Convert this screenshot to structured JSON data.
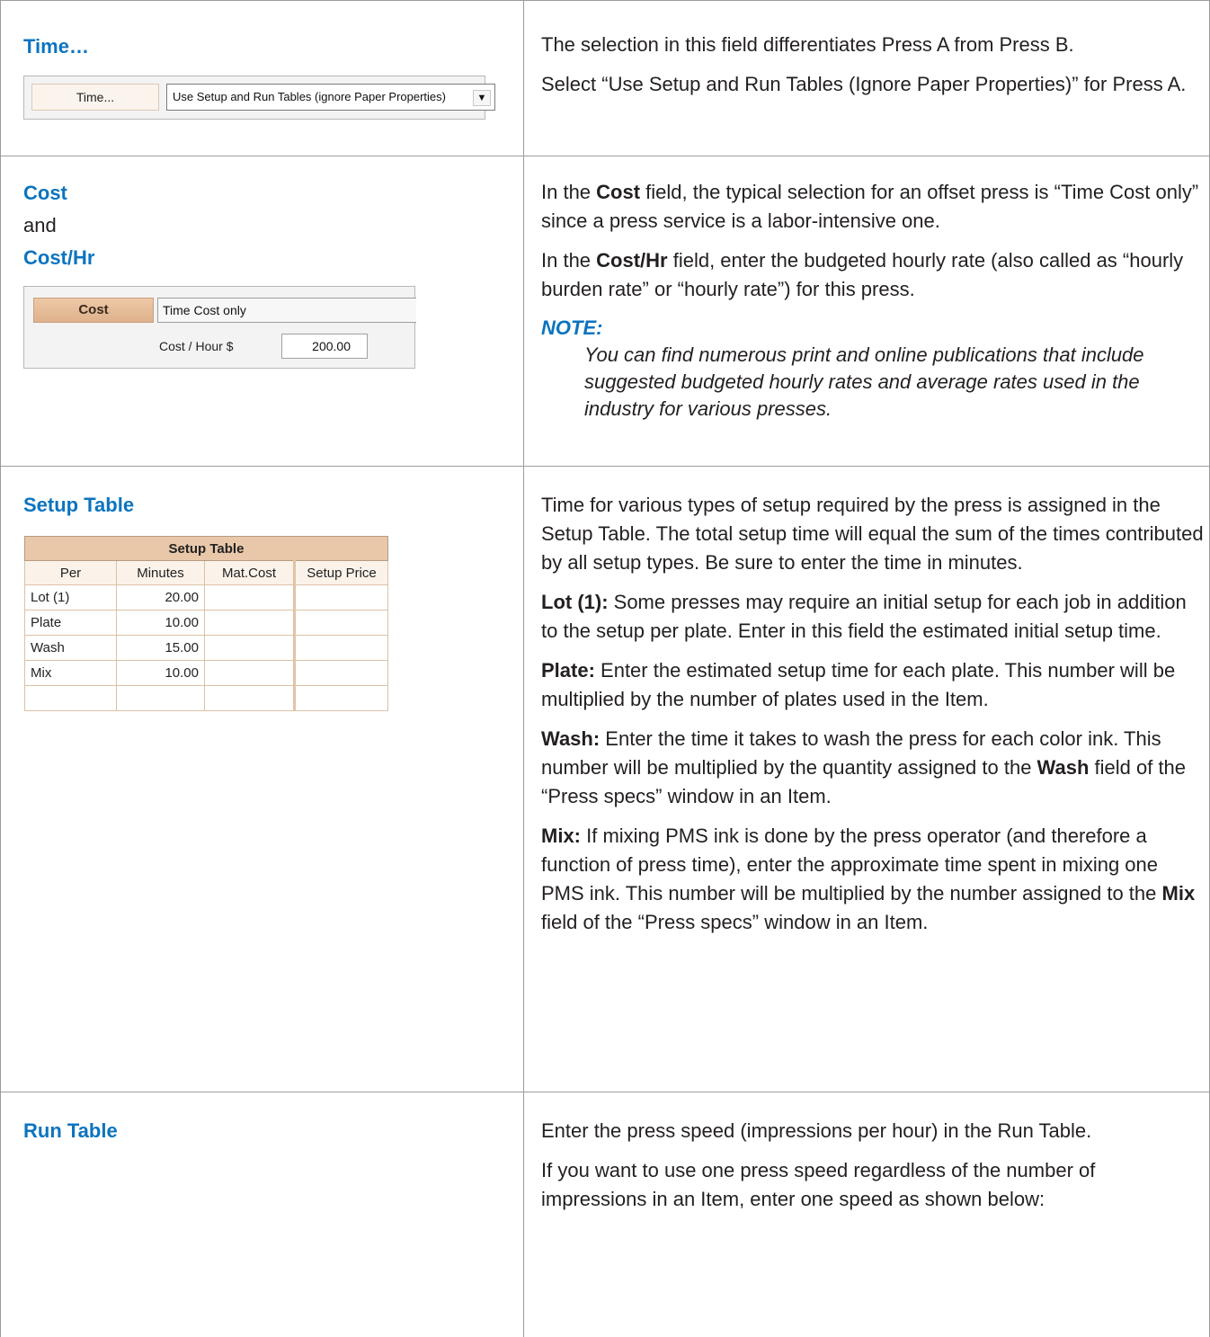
{
  "rows": [
    {
      "left": {
        "title": "Time…"
      },
      "widget": {
        "label": "Time...",
        "select_value": "Use Setup and Run Tables (ignore Paper Properties)",
        "arrow": "chevron-down-icon"
      },
      "right": [
        "The selection in this field differentiates Press A from Press B.",
        "Select “Use Setup and Run Tables (Ignore Paper Properties)” for Press A."
      ]
    },
    {
      "left": {
        "title1": "Cost",
        "and": "and",
        "title2": "Cost/Hr"
      },
      "widget": {
        "cost_label": "Cost",
        "cost_value": "Time Cost only",
        "costhr_label": "Cost / Hour  $",
        "costhr_value": "200.00"
      },
      "right": {
        "p1_pre": "In the ",
        "p1_bold": "Cost",
        "p1_post": " field, the typical selection for an offset press is “Time Cost only” since a press service is a labor-intensive one.",
        "p2_pre": "In the ",
        "p2_bold": "Cost/Hr",
        "p2_post": " field, enter the budgeted hourly rate (also called as “hourly burden rate” or “hourly rate”) for this press.",
        "note_title": "NOTE:",
        "note_text": "You can find numerous print and online publications that include suggested budgeted hourly rates and average rates used in the industry for various presses."
      }
    },
    {
      "left": {
        "title": "Setup Table"
      },
      "table": {
        "caption": "Setup Table",
        "headers": [
          "Per",
          "Minutes",
          "Mat.Cost",
          "Setup Price"
        ],
        "rows": [
          [
            "Lot (1)",
            "20.00",
            "",
            ""
          ],
          [
            "Plate",
            "10.00",
            "",
            ""
          ],
          [
            "Wash",
            "15.00",
            "",
            ""
          ],
          [
            "Mix",
            "10.00",
            "",
            ""
          ],
          [
            "",
            "",
            "",
            ""
          ]
        ]
      },
      "right": {
        "intro": "Time for various types of setup required by the press is assigned in the Setup Table. The total setup time will equal the sum of the times contributed by all setup types. Be sure to enter the time in minutes.",
        "lot_bold": "Lot (1):",
        "lot_text": " Some presses may require an initial setup for each job in addition to the setup per plate. Enter in this field the estimated initial setup time.",
        "plate_bold": "Plate:",
        "plate_text": " Enter the estimated setup time for each plate. This number will be multiplied by the number of plates used in the Item.",
        "wash_bold": "Wash:",
        "wash_text1": " Enter the time it takes to wash the press for each color ink. This number will be multiplied by the quantity assigned to the ",
        "wash_bold2": "Wash",
        "wash_text2": " field of the “Press specs” window in an Item.",
        "mix_bold": "Mix:",
        "mix_text1": " If mixing PMS ink is done by the press operator (and therefore a function of press time), enter the approximate time spent in mixing one PMS ink. This number will be multiplied by the number assigned to the ",
        "mix_bold2": "Mix",
        "mix_text2": " field of the “Press specs” window in an Item."
      }
    },
    {
      "left": {
        "title": "Run Table"
      },
      "right": [
        "Enter the press speed (impressions per hour) in the Run Table.",
        "If you want to use one press speed regardless of the number of impressions in an Item, enter one speed as shown below:"
      ]
    }
  ]
}
